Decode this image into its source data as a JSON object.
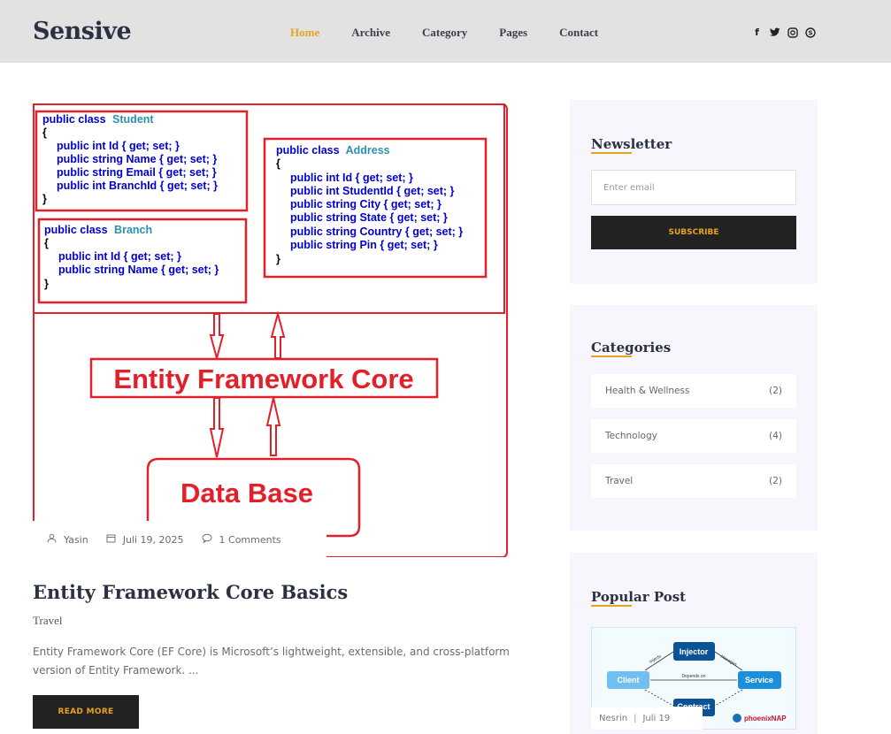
{
  "header": {
    "logo": "Sensive",
    "nav": [
      "Home",
      "Archive",
      "Category",
      "Pages",
      "Contact"
    ],
    "active_nav": "Home",
    "social_icons": [
      "facebook-icon",
      "twitter-icon",
      "instagram-icon",
      "skype-icon"
    ],
    "social_glyphs": [
      "f",
      "🐦",
      "◎",
      "Ⓢ"
    ]
  },
  "diagram": {
    "student_class": [
      "public class",
      "Student"
    ],
    "student_lines": [
      "{",
      "public int Id { get; set; }",
      "public string Name { get; set; }",
      "public string Email { get; set; }",
      "public int BranchId { get; set; }",
      "}"
    ],
    "branch_class": [
      "public class",
      "Branch"
    ],
    "branch_lines": [
      "{",
      "public int Id { get; set; }",
      "public string Name { get; set; }",
      "}"
    ],
    "address_class": [
      "public class",
      "Address"
    ],
    "address_lines": [
      "{",
      "public int Id { get; set; }",
      "public int StudentId { get; set; }",
      "public string City { get; set; }",
      "public string State { get; set; }",
      "public string Country { get; set; }",
      "public string Pin { get; set; }",
      "}"
    ],
    "ef_label": "Entity Framework Core",
    "db_label": "Data Base"
  },
  "post": {
    "author": "Yasin",
    "date": "Juli 19, 2025",
    "comments": "1 Comments",
    "title": "Entity Framework Core Basics",
    "category": "Travel",
    "excerpt": "Entity Framework Core (EF Core) is Microsoft’s lightweight, extensible, and cross-platform version of Entity Framework. ...",
    "read_more": "READ MORE"
  },
  "sidebar": {
    "newsletter": {
      "title": "Newsletter",
      "placeholder": "Enter email",
      "button": "SUBSCRIBE"
    },
    "categories": {
      "title": "Categories",
      "items": [
        {
          "name": "Health & Wellness",
          "count": "(2)"
        },
        {
          "name": "Technology",
          "count": "(4)"
        },
        {
          "name": "Travel",
          "count": "(2)"
        }
      ]
    },
    "popular": {
      "title": "Popular Post",
      "author": "Nesrin",
      "date": "Juli 19",
      "image_labels": [
        "Injector",
        "Client",
        "Service",
        "Contract",
        "Injects",
        "Manages",
        "Depends on",
        "phoenixNAP"
      ]
    }
  },
  "colors": {
    "accent": "#e9a21f",
    "header_bg": "#e2e2e2",
    "diagram_red": "#e3202a",
    "code_blue": "#0000d0",
    "class_teal": "#2b91af"
  }
}
